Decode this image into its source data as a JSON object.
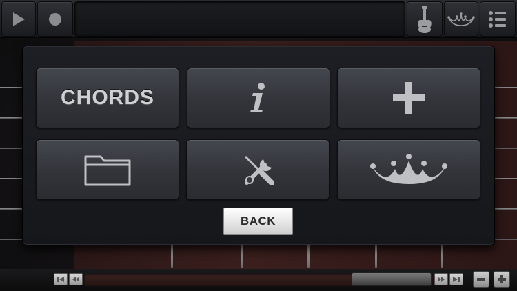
{
  "toolbar": {
    "play_icon": "play-icon",
    "record_icon": "record-icon",
    "guitar_icon": "guitar-icon",
    "crown_icon": "crown-icon",
    "menu_icon": "menu-list-icon"
  },
  "menu": {
    "chords_label": "CHORDS",
    "info_icon": "info-icon",
    "add_icon": "plus-icon",
    "folder_icon": "folder-icon",
    "tools_icon": "tools-icon",
    "crown_icon": "crown-icon",
    "back_label": "BACK"
  },
  "colors": {
    "tile_text": "#cfd0d2",
    "icon_fill": "#bfc0c3",
    "back_text": "#2a2a2a"
  }
}
